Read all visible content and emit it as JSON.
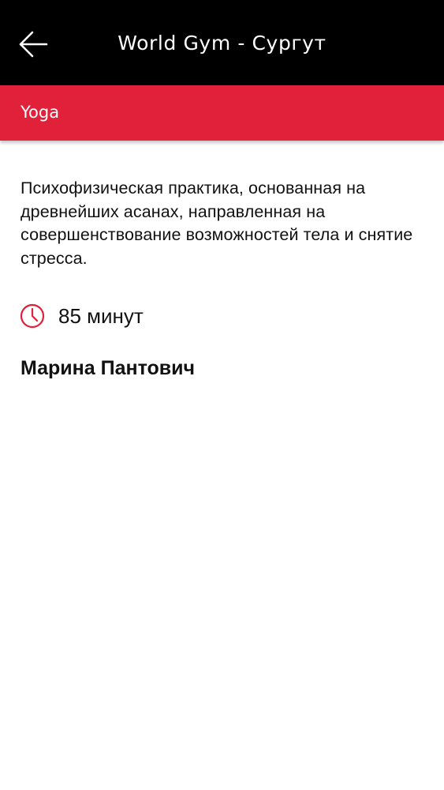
{
  "header": {
    "title": "World Gym - Сургут",
    "back_icon": "arrow-left-icon"
  },
  "category": {
    "label": "Yoga",
    "color": "#e1203a"
  },
  "class_info": {
    "description": "Психофизическая практика, основанная на древнейших асанах, направленная на совершенствование возможностей тела и снятие стресса.",
    "duration": "85 минут",
    "duration_icon": "clock-icon",
    "trainer": "Марина Пантович"
  },
  "colors": {
    "header_bg": "#000000",
    "accent": "#e1203a",
    "text": "#111111"
  }
}
